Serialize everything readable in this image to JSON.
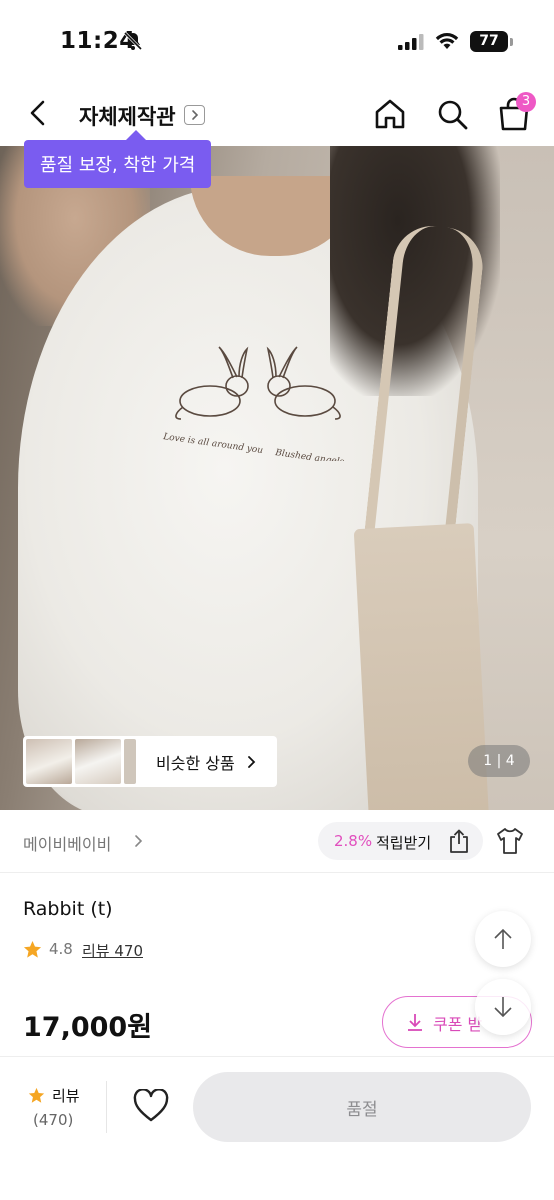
{
  "status_bar": {
    "time": "11:24",
    "battery": "77",
    "icons": [
      "bell-off-icon",
      "signal-icon",
      "wifi-icon",
      "battery-icon"
    ]
  },
  "nav": {
    "store_title": "자체제작관",
    "cart_count": "3",
    "icons": [
      "back-arrow-icon",
      "chevron-right-icon",
      "home-icon",
      "search-icon",
      "shopping-bag-icon"
    ]
  },
  "hero": {
    "similar_label": "비슷한 상품",
    "page_indicator": "1 | 4",
    "print_text_left": "Love is all around you",
    "print_text_right": "Blushed angels",
    "accent_color": "#7a5cf0"
  },
  "banner": {
    "text": "품질 보장, 착한 가격"
  },
  "seller": {
    "name": "메이비베이비",
    "points_percent": "2.8%",
    "points_label": "적립받기",
    "icons": [
      "share-icon",
      "tshirt-icon"
    ]
  },
  "product": {
    "name": "Rabbit (t)",
    "rating": "4.8",
    "review_link": "리뷰 470",
    "price": "17,000원",
    "coupon_label": "쿠폰 받"
  },
  "bottom_bar": {
    "review_label": "리뷰",
    "review_count": "(470)",
    "primary_button": "품절",
    "colors": {
      "star": "#f5a623",
      "pink": "#e14fbe",
      "disabled_bg": "#e9e9eb"
    }
  }
}
